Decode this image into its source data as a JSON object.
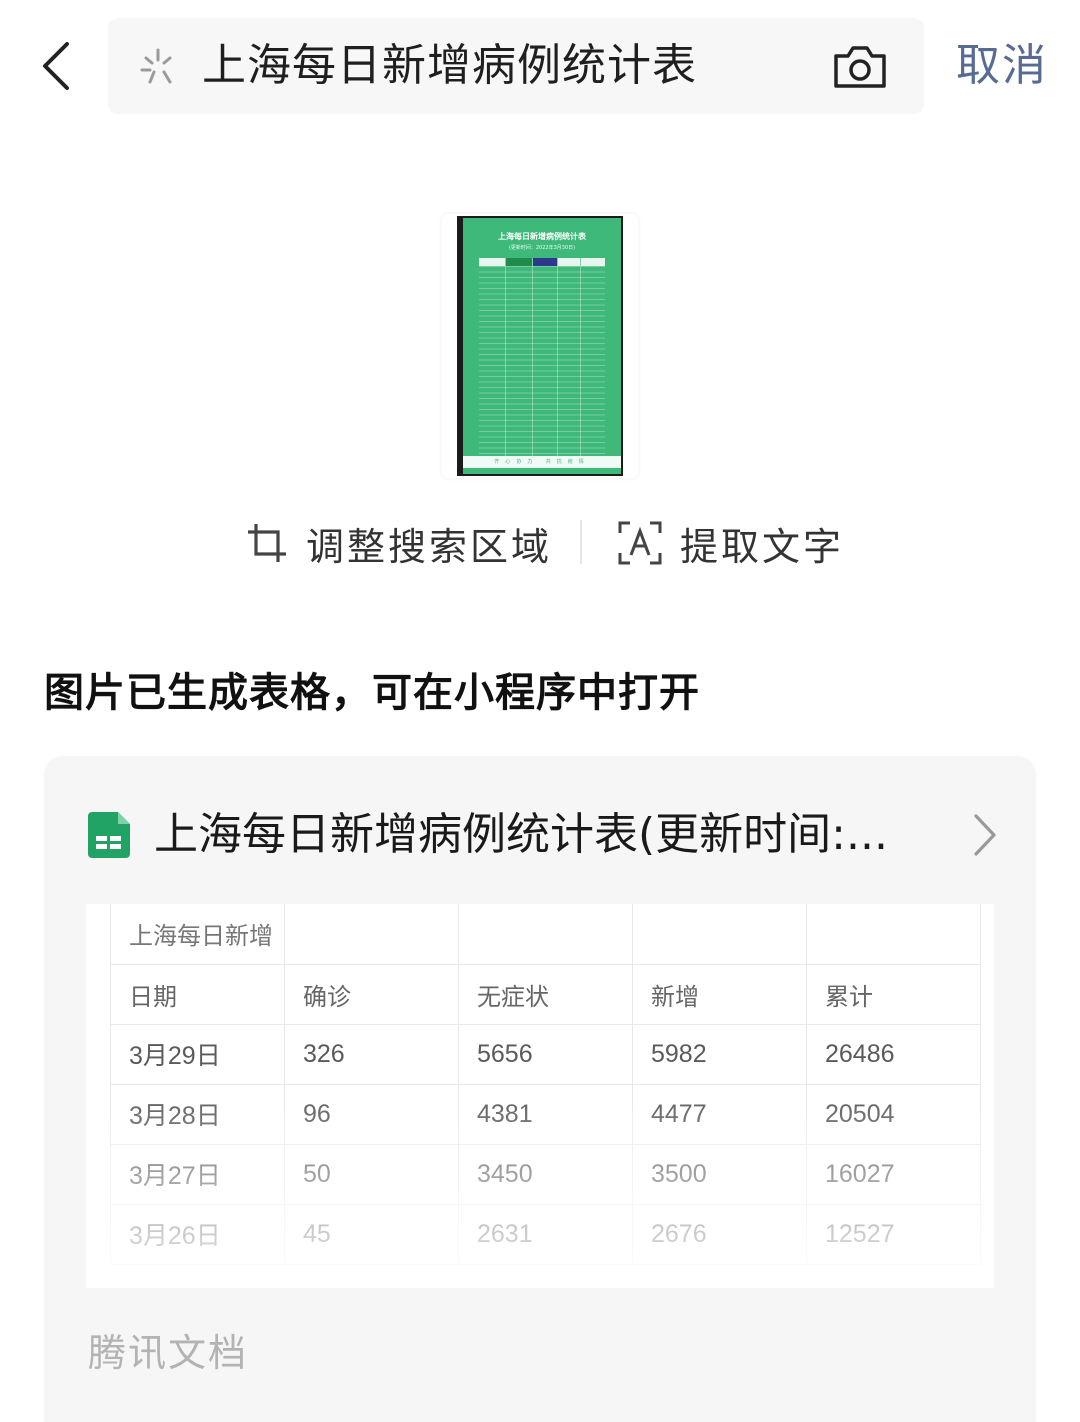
{
  "search": {
    "query": "上海每日新增病例统计表",
    "cancel_label": "取消"
  },
  "thumbnail": {
    "title": "上海每日新增病例统计表",
    "subtitle": "(更新时间：2022年3月30日)",
    "columns": [
      "日期",
      "确诊",
      "无症状",
      "新增",
      "累计"
    ],
    "footer": "齐心协力 共抗疫情",
    "colors": {
      "sheet": "#3fb97a",
      "header_confirm": "#1f8a4c",
      "header_asym": "#2b3a8f"
    }
  },
  "actions": {
    "crop_label": "调整搜索区域",
    "extract_label": "提取文字"
  },
  "section_title": "图片已生成表格，可在小程序中打开",
  "card": {
    "title": "上海每日新增病例统计表(更新时间:...",
    "source": "腾讯文档",
    "table": {
      "title_cell": "上海每日新增",
      "headers": [
        "日期",
        "确诊",
        "无症状",
        "新增",
        "累计"
      ],
      "rows": [
        [
          "3月29日",
          "326",
          "5656",
          "5982",
          "26486"
        ],
        [
          "3月28日",
          "96",
          "4381",
          "4477",
          "20504"
        ],
        [
          "3月27日",
          "50",
          "3450",
          "3500",
          "16027"
        ],
        [
          "3月26日",
          "45",
          "2631",
          "2676",
          "12527"
        ]
      ]
    }
  }
}
